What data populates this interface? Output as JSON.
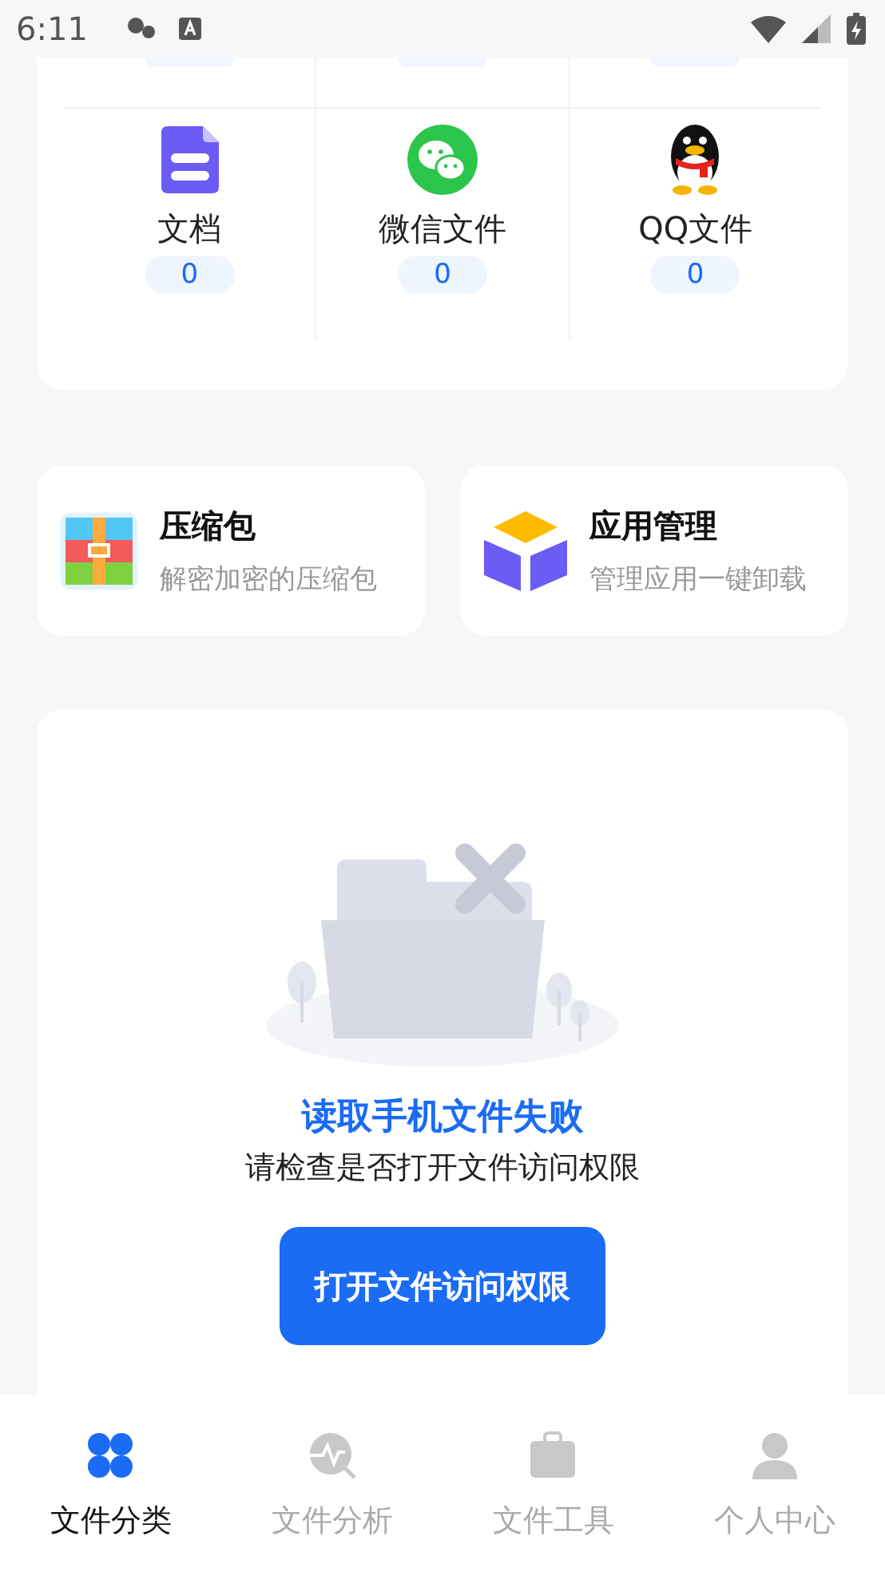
{
  "status_bar": {
    "time": "6:11"
  },
  "categories": [
    {
      "kind": "doc",
      "label": "文档",
      "count": "0"
    },
    {
      "kind": "wechat",
      "label": "微信文件",
      "count": "0"
    },
    {
      "kind": "qq",
      "label": "QQ文件",
      "count": "0"
    }
  ],
  "tools": [
    {
      "kind": "zip",
      "title": "压缩包",
      "subtitle": "解密加密的压缩包"
    },
    {
      "kind": "apps",
      "title": "应用管理",
      "subtitle": "管理应用一键卸载"
    }
  ],
  "empty_state": {
    "title": "读取手机文件失败",
    "message": "请检查是否打开文件访问权限",
    "button": "打开文件访问权限"
  },
  "nav": [
    {
      "kind": "category",
      "label": "文件分类",
      "selected": true
    },
    {
      "kind": "analysis",
      "label": "文件分析",
      "selected": false
    },
    {
      "kind": "tools",
      "label": "文件工具",
      "selected": false
    },
    {
      "kind": "profile",
      "label": "个人中心",
      "selected": false
    }
  ]
}
